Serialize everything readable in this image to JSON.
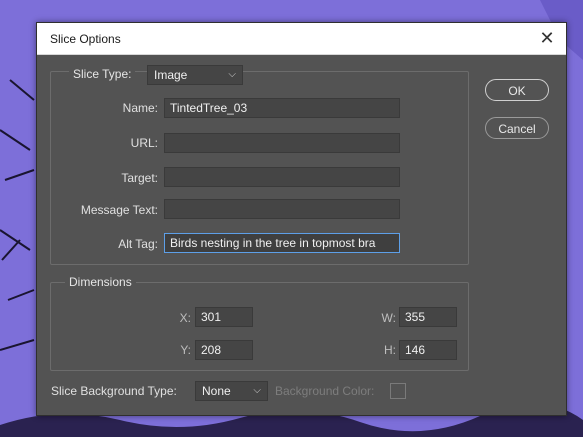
{
  "dialog": {
    "title": "Slice Options",
    "close_icon": "close-icon"
  },
  "slice_group": {
    "slice_type_label": "Slice Type:",
    "slice_type_value": "Image",
    "name_label": "Name:",
    "name_value": "TintedTree_03",
    "url_label": "URL:",
    "url_value": "",
    "target_label": "Target:",
    "target_value": "",
    "message_label": "Message Text:",
    "message_value": "",
    "alt_label": "Alt Tag:",
    "alt_value": "Birds nesting in the tree in topmost bra"
  },
  "dimensions": {
    "legend": "Dimensions",
    "x_label": "X:",
    "x_value": "301",
    "y_label": "Y:",
    "y_value": "208",
    "w_label": "W:",
    "w_value": "355",
    "h_label": "H:",
    "h_value": "146"
  },
  "bottom": {
    "bg_type_label": "Slice Background Type:",
    "bg_type_value": "None",
    "bg_color_label": "Background Color:"
  },
  "buttons": {
    "ok": "OK",
    "cancel": "Cancel"
  },
  "colors": {
    "dialog_bg": "#535353",
    "background": "#7d6fd9",
    "focus": "#5d9fe8"
  }
}
